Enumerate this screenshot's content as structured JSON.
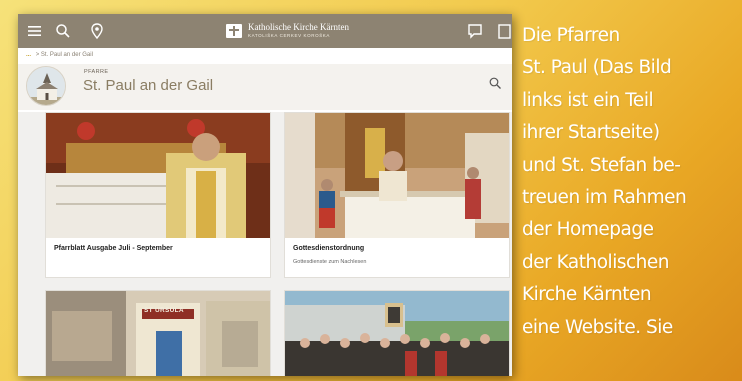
{
  "topbar": {
    "brand_name": "Katholische Kirche Kärnten",
    "brand_sub": "KATOLIŠKA CERKEV KOROŠKA"
  },
  "breadcrumb": {
    "dots": "...",
    "separator": ">",
    "current": "St. Paul an der Gail"
  },
  "parish": {
    "label": "PFARRE",
    "title": "St. Paul an der Gail"
  },
  "cards": [
    {
      "title": "Pfarrblatt Ausgabe Juli - September",
      "subtitle": ""
    },
    {
      "title": "Gottesdienstordnung",
      "subtitle": "Gottesdienste zum Nachlesen"
    },
    {
      "title": "",
      "subtitle": "",
      "sign": "ST URSULA"
    },
    {
      "title": "",
      "subtitle": ""
    }
  ],
  "side_text": {
    "lines": [
      "Die Pfarren",
      "St. Paul (Das Bild",
      "links ist ein Teil",
      "ihrer Startseite)",
      "und  St. Stefan be-",
      "treuen im Rahmen",
      "der Homepage",
      "der Katholischen",
      "Kirche Kärnten",
      "eine Website. Sie"
    ]
  },
  "colors": {
    "topbar": "#8d8372",
    "title": "#8a7d63",
    "gradient_start": "#f6e27a",
    "gradient_end": "#d98b1a"
  },
  "icons": [
    "menu-icon",
    "search-icon",
    "location-pin-icon",
    "chat-icon",
    "document-icon",
    "church-icon"
  ]
}
